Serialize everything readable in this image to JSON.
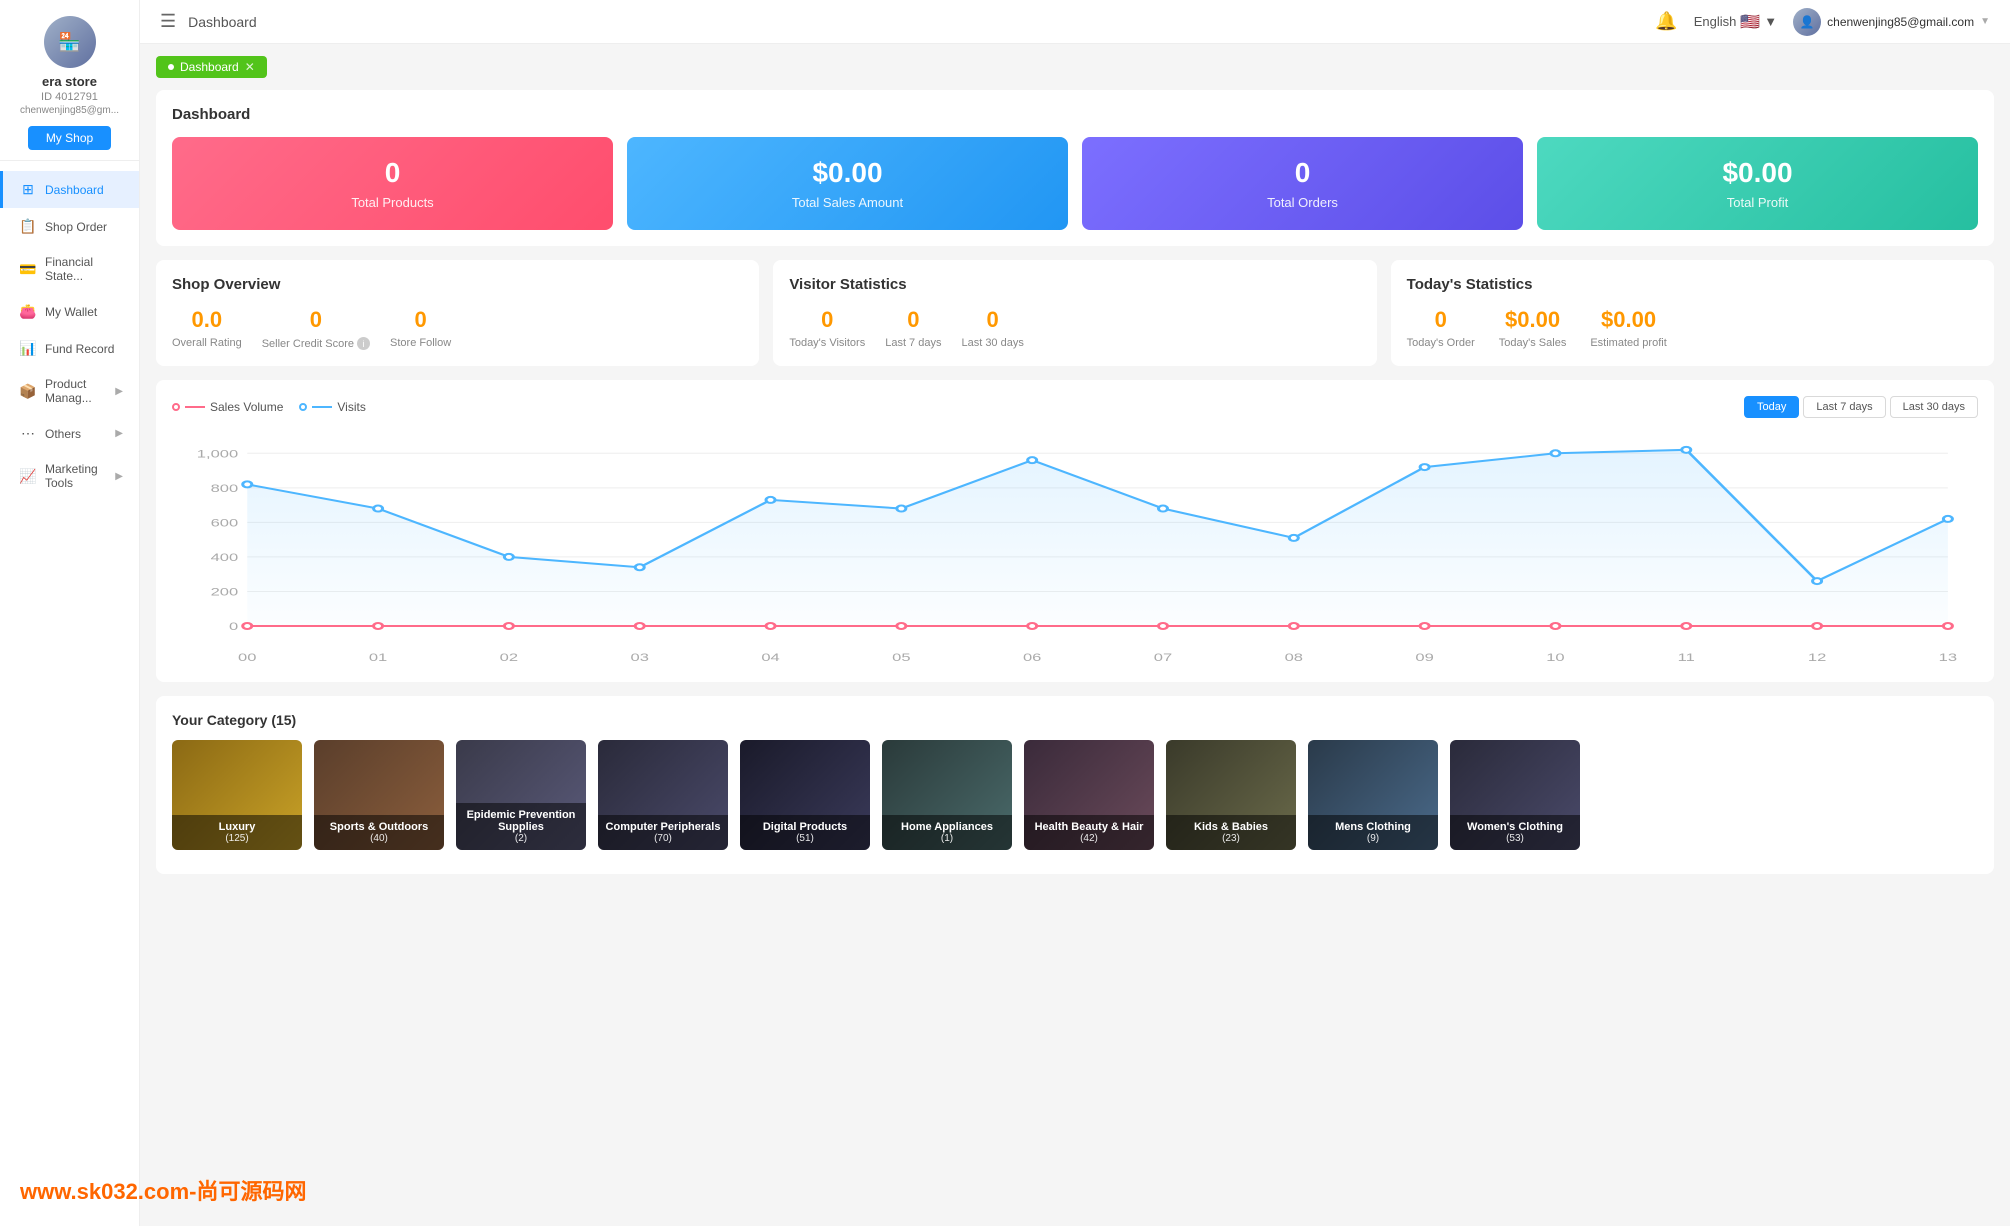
{
  "sidebar": {
    "store_name": "era store",
    "store_id": "ID 4012791",
    "store_email": "chenwenjing85@gm...",
    "myshop_label": "My Shop",
    "items": [
      {
        "id": "dashboard",
        "label": "Dashboard",
        "icon": "⊞",
        "active": true,
        "has_arrow": false
      },
      {
        "id": "shop-order",
        "label": "Shop Order",
        "icon": "📋",
        "active": false,
        "has_arrow": false
      },
      {
        "id": "financial",
        "label": "Financial State...",
        "icon": "💳",
        "active": false,
        "has_arrow": false
      },
      {
        "id": "my-wallet",
        "label": "My Wallet",
        "icon": "👛",
        "active": false,
        "has_arrow": false
      },
      {
        "id": "fund-record",
        "label": "Fund Record",
        "icon": "📊",
        "active": false,
        "has_arrow": false
      },
      {
        "id": "product-manag",
        "label": "Product Manag...",
        "icon": "📦",
        "active": false,
        "has_arrow": true
      },
      {
        "id": "others",
        "label": "Others",
        "icon": "⋯",
        "active": false,
        "has_arrow": true
      },
      {
        "id": "marketing",
        "label": "Marketing Tools",
        "icon": "📈",
        "active": false,
        "has_arrow": true
      }
    ]
  },
  "topbar": {
    "title": "Dashboard",
    "language": "English",
    "user_email": "chenwenjing85@gmail.com"
  },
  "breadcrumb": {
    "label": "Dashboard",
    "icon": "●"
  },
  "dashboard": {
    "title": "Dashboard",
    "stat_cards": [
      {
        "id": "total-products",
        "value": "0",
        "label": "Total Products",
        "color": "pink"
      },
      {
        "id": "total-sales",
        "value": "$0.00",
        "label": "Total Sales Amount",
        "color": "blue"
      },
      {
        "id": "total-orders",
        "value": "0",
        "label": "Total Orders",
        "color": "purple"
      },
      {
        "id": "total-profit",
        "value": "$0.00",
        "label": "Total Profit",
        "color": "teal"
      }
    ]
  },
  "shop_overview": {
    "title": "Shop Overview",
    "stats": [
      {
        "id": "overall-rating",
        "value": "0.0",
        "label": "Overall Rating",
        "has_info": false
      },
      {
        "id": "seller-credit",
        "value": "0",
        "label": "Seller Credit Score",
        "has_info": true
      },
      {
        "id": "store-follow",
        "value": "0",
        "label": "Store Follow",
        "has_info": false
      }
    ]
  },
  "visitor_stats": {
    "title": "Visitor Statistics",
    "stats": [
      {
        "id": "todays-visitors",
        "value": "0",
        "label": "Today's Visitors"
      },
      {
        "id": "last-7-days",
        "value": "0",
        "label": "Last 7 days"
      },
      {
        "id": "last-30-days",
        "value": "0",
        "label": "Last 30 days"
      }
    ]
  },
  "todays_stats": {
    "title": "Today's Statistics",
    "stats": [
      {
        "id": "todays-order",
        "value": "0",
        "label": "Today's Order"
      },
      {
        "id": "todays-sales",
        "value": "$0.00",
        "label": "Today's Sales"
      },
      {
        "id": "estimated-profit",
        "value": "$0.00",
        "label": "Estimated profit"
      }
    ]
  },
  "chart": {
    "legend_sales": "Sales Volume",
    "legend_visits": "Visits",
    "buttons": [
      "Today",
      "Last 7 days",
      "Last 30 days"
    ],
    "active_button": "Today",
    "x_labels": [
      "00",
      "01",
      "02",
      "03",
      "04",
      "05",
      "06",
      "07",
      "08",
      "09",
      "10",
      "11",
      "12",
      "13"
    ],
    "y_labels": [
      "0",
      "200",
      "400",
      "600",
      "800",
      "1,000"
    ],
    "visits_data": [
      820,
      680,
      400,
      340,
      730,
      680,
      960,
      680,
      510,
      920,
      1000,
      1020,
      260,
      620
    ],
    "sales_data": [
      0,
      0,
      0,
      0,
      0,
      0,
      0,
      0,
      0,
      0,
      0,
      0,
      0,
      0
    ]
  },
  "categories": {
    "title": "Your Category",
    "count": 15,
    "items": [
      {
        "id": "luxury",
        "name": "Luxury",
        "count": "(125)",
        "color": "luxury"
      },
      {
        "id": "sports",
        "name": "Sports & Outdoors",
        "count": "(40)",
        "color": "sports"
      },
      {
        "id": "epidemic",
        "name": "Epidemic Prevention Supplies",
        "count": "(2)",
        "color": "epidemic"
      },
      {
        "id": "computer",
        "name": "Computer Peripherals",
        "count": "(70)",
        "color": "computer"
      },
      {
        "id": "digital",
        "name": "Digital Products",
        "count": "(51)",
        "color": "digital"
      },
      {
        "id": "appliances",
        "name": "Home Appliances",
        "count": "(1)",
        "color": "appliances"
      },
      {
        "id": "health",
        "name": "Health Beauty & Hair",
        "count": "(42)",
        "color": "health"
      },
      {
        "id": "kids",
        "name": "Kids & Babies",
        "count": "(23)",
        "color": "kids"
      },
      {
        "id": "mens",
        "name": "Mens Clothing",
        "count": "(9)",
        "color": "mens"
      },
      {
        "id": "womens",
        "name": "Women's Clothing",
        "count": "(53)",
        "color": "womens"
      }
    ]
  },
  "watermark": "www.sk032.com-尚可源码网"
}
